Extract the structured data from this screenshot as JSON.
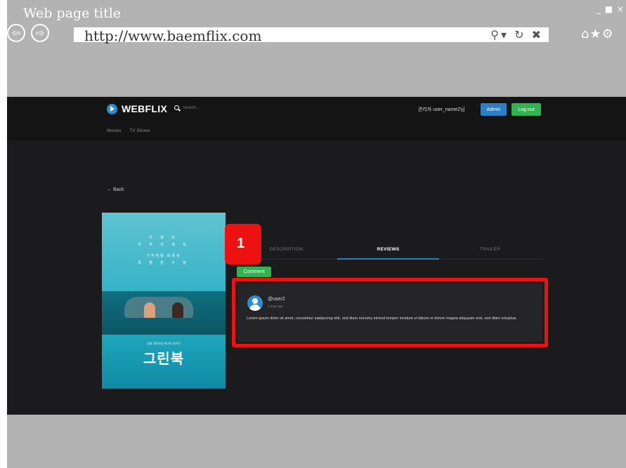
{
  "browser": {
    "page_title": "Web page title",
    "window_controls": "_ ■ ×",
    "back_glyph": "⇦",
    "forward_glyph": "⇨",
    "url": "http://www.baemflix.com",
    "url_icons": "⚲▾ ↻ ✖",
    "toolbar_icons": "⌂★⚙"
  },
  "header": {
    "logo_text": "WEBFLIX",
    "search_placeholder": "Search...",
    "greeting": "관리자 user_name2님",
    "admin_label": "Admin",
    "logout_label": "Log out",
    "nav": [
      "Movies",
      "TV Shows"
    ]
  },
  "movie": {
    "back_label": "← Back",
    "poster_tagline_1": "우 정 의",
    "poster_tagline_2": "우 주 의 세 상",
    "poster_tagline_3": "기적처럼 따뜻한",
    "poster_tagline_4": "특 별 한 우 정",
    "poster_title": "그린북",
    "poster_subtitle": "실화 영화사상 최고의 이야기"
  },
  "tabs": [
    {
      "label": "DESCRIPTION",
      "active": false
    },
    {
      "label": "REVIEWS",
      "active": true
    },
    {
      "label": "TRAILER",
      "active": false
    }
  ],
  "comment_label": "Comment",
  "review": {
    "user": "@user2",
    "time": "2 days ago",
    "body": "Lorem ipsum dolor sit amet, consetetur sadipscing elitr, sed diam nonumy eirmod tempor invidunt ut labore et dolore magna aliquyam erat, sed diam voluptua."
  },
  "annotation_number": "1",
  "colors": {
    "accent_blue": "#2a7fc5",
    "accent_green": "#2fb44f",
    "highlight_red": "#ee1111"
  }
}
